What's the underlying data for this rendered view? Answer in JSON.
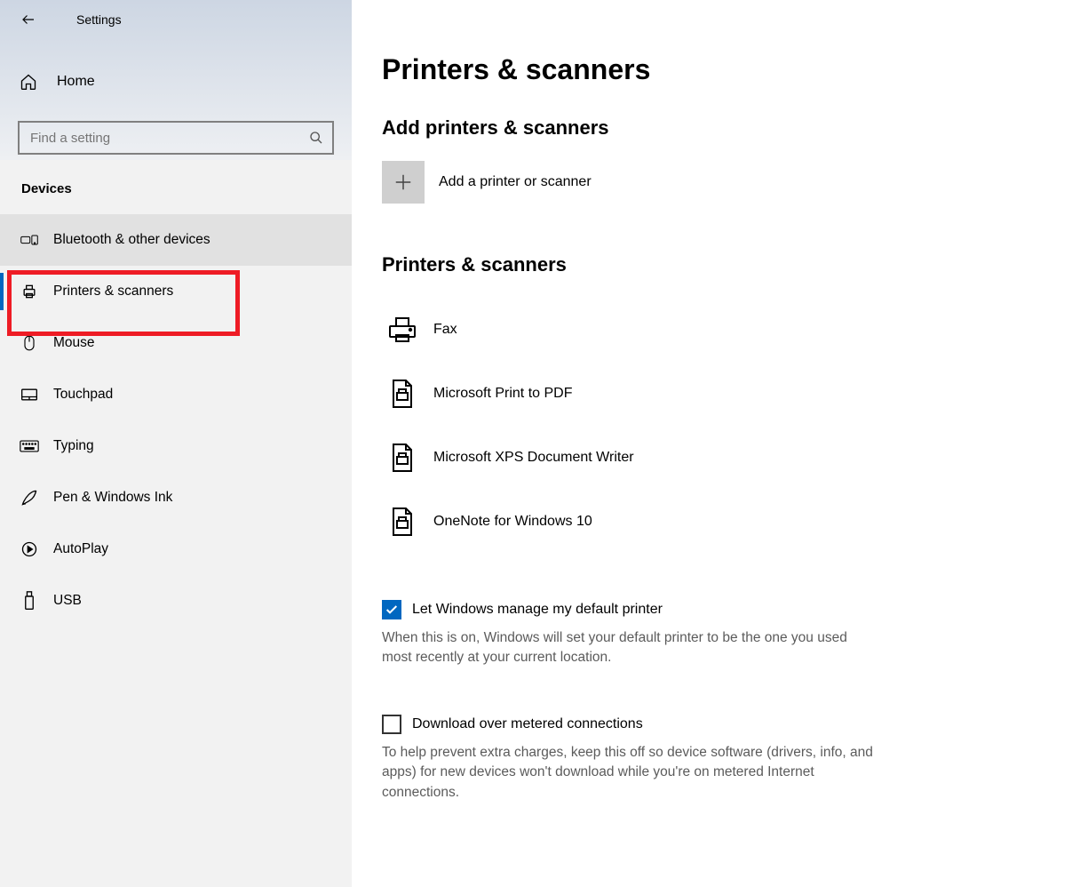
{
  "app": {
    "title": "Settings"
  },
  "sidebar": {
    "home": "Home",
    "search_placeholder": "Find a setting",
    "section": "Devices",
    "items": [
      {
        "label": "Bluetooth & other devices"
      },
      {
        "label": "Printers & scanners",
        "selected": true
      },
      {
        "label": "Mouse"
      },
      {
        "label": "Touchpad"
      },
      {
        "label": "Typing"
      },
      {
        "label": "Pen & Windows Ink"
      },
      {
        "label": "AutoPlay"
      },
      {
        "label": "USB"
      }
    ]
  },
  "main": {
    "title": "Printers & scanners",
    "add_section": "Add printers & scanners",
    "add_label": "Add a printer or scanner",
    "list_heading": "Printers & scanners",
    "printers": [
      {
        "label": "Fax"
      },
      {
        "label": "Microsoft Print to PDF"
      },
      {
        "label": "Microsoft XPS Document Writer"
      },
      {
        "label": "OneNote for Windows 10"
      }
    ],
    "opt1": {
      "label": "Let Windows manage my default printer",
      "desc": "When this is on, Windows will set your default printer to be the one you used most recently at your current location.",
      "checked": true
    },
    "opt2": {
      "label": "Download over metered connections",
      "desc": "To help prevent extra charges, keep this off so device software (drivers, info, and apps) for new devices won't download while you're on metered Internet connections.",
      "checked": false
    }
  }
}
